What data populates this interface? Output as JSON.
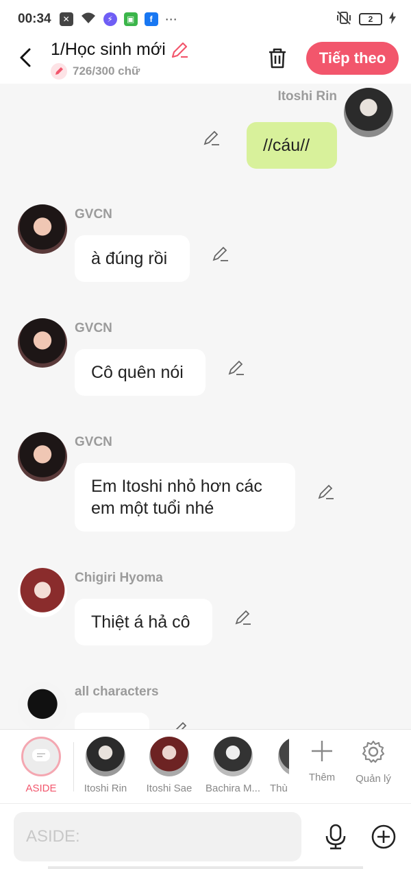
{
  "status_bar": {
    "time": "00:34",
    "battery": "2",
    "icons": [
      "close-square-icon",
      "wifi-icon",
      "messenger-icon",
      "store-icon",
      "facebook-icon",
      "more-dots-icon"
    ]
  },
  "header": {
    "title": "1/Học sinh mới",
    "word_count": "726/300 chữ",
    "next_label": "Tiếp theo"
  },
  "messages": [
    {
      "sender": "Itoshi Rin",
      "text": "//cáu//",
      "side": "right"
    },
    {
      "sender": "GVCN",
      "text": "à đúng rồi",
      "side": "left"
    },
    {
      "sender": "GVCN",
      "text": "Cô quên nói",
      "side": "left"
    },
    {
      "sender": "GVCN",
      "text": "Em Itoshi nhỏ hơn các em một tuổi nhé",
      "side": "left"
    },
    {
      "sender": "Chigiri Hyoma",
      "text": "Thiệt á hả cô",
      "side": "left"
    },
    {
      "sender": "all characters",
      "text": "",
      "side": "left"
    }
  ],
  "characters": [
    {
      "label": "ASIDE"
    },
    {
      "label": "Itoshi Rin"
    },
    {
      "label": "Itoshi Sae"
    },
    {
      "label": "Bachira M..."
    },
    {
      "label": "Thù"
    }
  ],
  "tools": {
    "add_label": "Thêm",
    "manage_label": "Quản lý"
  },
  "input": {
    "placeholder": "ASIDE:"
  },
  "colors": {
    "accent": "#f2566c",
    "my_bubble": "#d8f19b",
    "background": "#f6f6f6"
  }
}
